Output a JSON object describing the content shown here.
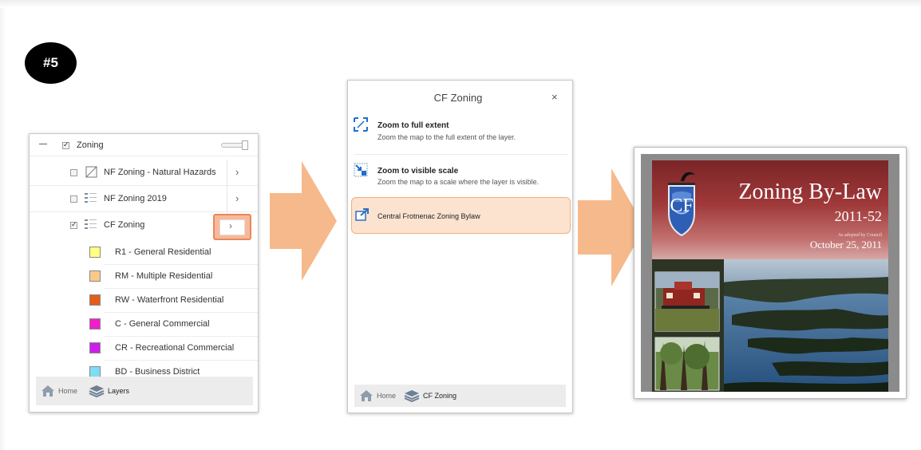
{
  "badge": "#5",
  "layers_panel": {
    "group_label": "Zoning",
    "layers": [
      {
        "label": "NF Zoning - Natural Hazards",
        "checked": false
      },
      {
        "label": "NF Zoning 2019",
        "checked": false
      },
      {
        "label": "CF Zoning",
        "checked": true
      }
    ],
    "legend": [
      {
        "label": "R1 - General Residential",
        "color": "#ffff80"
      },
      {
        "label": "RM - Multiple Residential",
        "color": "#f9c98a"
      },
      {
        "label": "RW - Waterfront Residential",
        "color": "#e35d1b"
      },
      {
        "label": "C - General Commercial",
        "color": "#f21ecb"
      },
      {
        "label": "CR - Recreational Commercial",
        "color": "#cc1ee8"
      },
      {
        "label": "BD - Business District",
        "color": "#7fdcf5"
      }
    ],
    "tabs": {
      "home": "Home",
      "layers": "Layers"
    }
  },
  "layer_menu": {
    "title": "CF Zoning",
    "close_icon": "×",
    "actions": [
      {
        "title": "Zoom to full extent",
        "desc": "Zoom the map to the full extent of the layer."
      },
      {
        "title": "Zoom to visible scale",
        "desc": "Zoom the map to a scale where the layer is visible."
      }
    ],
    "bylaw_link": "Central Frotnenac Zoning Bylaw",
    "tabs": {
      "home": "Home",
      "layer": "CF Zoning"
    }
  },
  "document": {
    "title": "Zoning By-Law",
    "number": "2011-52",
    "adopted_note": "As adopted by Council",
    "date": "October 25, 2011"
  },
  "colors": {
    "arrow_fill": "#f6b98c",
    "highlight_fill": "#fbe3d0",
    "highlight_border": "#f0b07e",
    "tab_icon": "#6d7f93"
  }
}
